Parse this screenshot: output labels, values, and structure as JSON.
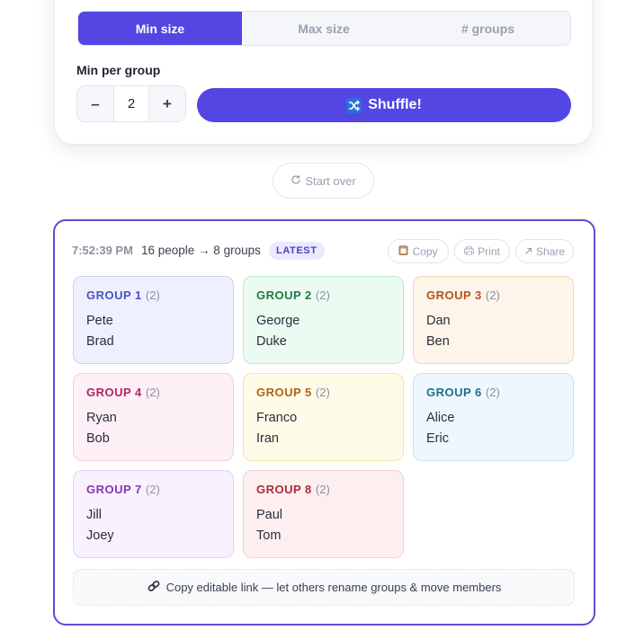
{
  "mode_tabs": [
    {
      "label": "Min size",
      "active": true
    },
    {
      "label": "Max size",
      "active": false
    },
    {
      "label": "# groups",
      "active": false
    }
  ],
  "min_per_group": {
    "label": "Min per group",
    "minus": "–",
    "value": "2",
    "plus": "+"
  },
  "shuffle_button": {
    "label": "Shuffle!",
    "icon": "shuffle-icon"
  },
  "start_over": {
    "label": "Start over",
    "icon": "refresh-icon"
  },
  "result": {
    "time": "7:52:39 PM",
    "summary": "16 people → 8 groups",
    "badge": "LATEST",
    "actions": {
      "copy": "Copy",
      "print": "Print",
      "share": "Share"
    },
    "groups": [
      {
        "title": "GROUP 1",
        "count": "(2)",
        "members": [
          "Pete",
          "Brad"
        ]
      },
      {
        "title": "GROUP 2",
        "count": "(2)",
        "members": [
          "George",
          "Duke"
        ]
      },
      {
        "title": "GROUP 3",
        "count": "(2)",
        "members": [
          "Dan",
          "Ben"
        ]
      },
      {
        "title": "GROUP 4",
        "count": "(2)",
        "members": [
          "Ryan",
          "Bob"
        ]
      },
      {
        "title": "GROUP 5",
        "count": "(2)",
        "members": [
          "Franco",
          "Iran"
        ]
      },
      {
        "title": "GROUP 6",
        "count": "(2)",
        "members": [
          "Alice",
          "Eric"
        ]
      },
      {
        "title": "GROUP 7",
        "count": "(2)",
        "members": [
          "Jill",
          "Joey"
        ]
      },
      {
        "title": "GROUP 8",
        "count": "(2)",
        "members": [
          "Paul",
          "Tom"
        ]
      }
    ],
    "copy_link": "Copy editable link — let others rename groups & move members"
  },
  "colors": {
    "accent": "#5346e3",
    "card_border": "#5a4fd6"
  }
}
